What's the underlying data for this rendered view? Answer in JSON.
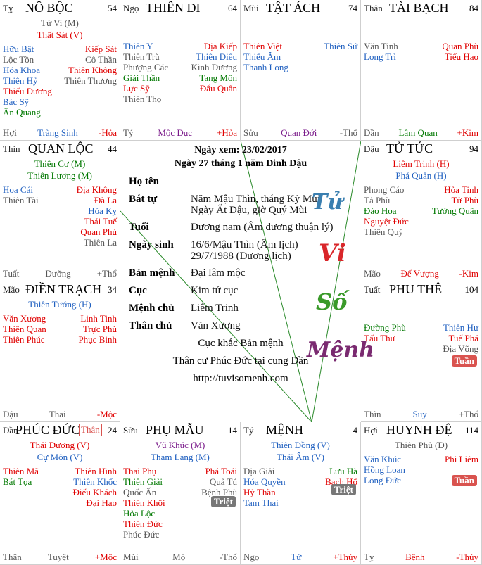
{
  "palaces": {
    "no_boc": {
      "branch": "Tỵ",
      "name": "NÔ BỘC",
      "num": "54",
      "main": [
        {
          "t": "Tử Vi (M)",
          "c": "gray"
        },
        {
          "t": "Thất Sát (V)",
          "c": "red"
        }
      ],
      "rows": [
        [
          "Hữu Bật",
          "blue",
          "Kiếp Sát",
          "red"
        ],
        [
          "Lộc Tồn",
          "gray",
          "Cô Thần",
          "gray"
        ],
        [
          "Hóa Khoa",
          "blue",
          "Thiên Không",
          "red"
        ],
        [
          "Thiên Hỷ",
          "blue",
          "Thiên Thương",
          "gray"
        ],
        [
          "Thiếu Dương",
          "red",
          "",
          ""
        ],
        [
          "Bác Sỹ",
          "blue",
          "",
          ""
        ],
        [
          "Ân Quang",
          "green",
          "",
          ""
        ]
      ],
      "bot": [
        "Hợi",
        "Tràng Sinh",
        "-Hỏa"
      ],
      "botc": [
        "gray",
        "blue",
        "red"
      ]
    },
    "thien_di": {
      "branch": "Ngọ",
      "name": "THIÊN DI",
      "num": "64",
      "main": [],
      "rows": [
        [
          "Thiên Y",
          "blue",
          "Địa Kiếp",
          "red"
        ],
        [
          "Thiên Trù",
          "gray",
          "Thiên Diêu",
          "blue"
        ],
        [
          "Phượng Các",
          "gray",
          "Kình Dương",
          "gray"
        ],
        [
          "Giải Thần",
          "green",
          "Tang Môn",
          "green"
        ],
        [
          "Lực Sỹ",
          "red",
          "Đẩu Quân",
          "red"
        ],
        [
          "Thiên Thọ",
          "gray",
          "",
          ""
        ]
      ],
      "bot": [
        "Tý",
        "Mộc Dục",
        "+Hỏa"
      ],
      "botc": [
        "gray",
        "purple",
        "red"
      ]
    },
    "tat_ach": {
      "branch": "Mùi",
      "name": "TẬT ÁCH",
      "num": "74",
      "main": [],
      "rows": [
        [
          "Thiên Việt",
          "red",
          "Thiên Sứ",
          "blue"
        ],
        [
          "Thiếu Âm",
          "blue",
          "",
          ""
        ],
        [
          "Thanh Long",
          "blue",
          "",
          ""
        ]
      ],
      "bot": [
        "Sửu",
        "Quan Đới",
        "-Thổ"
      ],
      "botc": [
        "gray",
        "purple",
        "gray"
      ]
    },
    "tai_bach": {
      "branch": "Thân",
      "name": "TÀI BẠCH",
      "num": "84",
      "main": [],
      "rows": [
        [
          "Văn Tinh",
          "gray",
          "Quan Phù",
          "red"
        ],
        [
          "Long Trì",
          "blue",
          "Tiểu Hao",
          "red"
        ]
      ],
      "bot": [
        "Dần",
        "Lâm Quan",
        "+Kim"
      ],
      "botc": [
        "gray",
        "green",
        "red"
      ]
    },
    "quan_loc": {
      "branch": "Thìn",
      "name": "QUAN LỘC",
      "num": "44",
      "main": [
        {
          "t": "Thiên Cơ (M)",
          "c": "green"
        },
        {
          "t": "Thiên Lương (M)",
          "c": "green"
        }
      ],
      "rows": [
        [
          "Hoa Cái",
          "blue",
          "Địa Không",
          "red"
        ],
        [
          "Thiên Tài",
          "gray",
          "Đà La",
          "red"
        ],
        [
          "",
          "",
          "Hóa Kỵ",
          "blue"
        ],
        [
          "",
          "",
          "Thái Tuế",
          "red"
        ],
        [
          "",
          "",
          "Quan Phủ",
          "red"
        ],
        [
          "",
          "",
          "Thiên La",
          "gray"
        ]
      ],
      "bot": [
        "Tuất",
        "Dưỡng",
        "+Thổ"
      ],
      "botc": [
        "gray",
        "gray",
        "gray"
      ]
    },
    "tu_tuc": {
      "branch": "Dậu",
      "name": "TỬ TỨC",
      "num": "94",
      "main": [
        {
          "t": "Liêm Trinh (H)",
          "c": "red"
        },
        {
          "t": "Phá Quân (H)",
          "c": "blue"
        }
      ],
      "rows": [
        [
          "Phong Cáo",
          "gray",
          "Hỏa Tinh",
          "red"
        ],
        [
          "Tả Phù",
          "gray",
          "Tử Phù",
          "red"
        ],
        [
          "Đào Hoa",
          "green",
          "Tướng Quân",
          "green"
        ],
        [
          "Nguyệt Đức",
          "red",
          "",
          ""
        ],
        [
          "Thiên Quý",
          "gray",
          "",
          ""
        ]
      ],
      "bot": [
        "Mão",
        "Đế Vượng",
        "-Kim"
      ],
      "botc": [
        "gray",
        "red",
        "red"
      ]
    },
    "dien_trach": {
      "branch": "Mão",
      "name": "ĐIỀN TRẠCH",
      "num": "34",
      "main": [
        {
          "t": "Thiên Tướng (H)",
          "c": "blue"
        }
      ],
      "rows": [
        [
          "Văn Xương",
          "red",
          "Linh Tinh",
          "red"
        ],
        [
          "Thiên Quan",
          "red",
          "Trực Phù",
          "red"
        ],
        [
          "Thiên Phúc",
          "red",
          "Phục Binh",
          "red"
        ]
      ],
      "bot": [
        "Dậu",
        "Thai",
        "-Mộc"
      ],
      "botc": [
        "gray",
        "gray",
        "red"
      ]
    },
    "phu_the": {
      "branch": "Tuất",
      "name": "PHU THÊ",
      "num": "104",
      "main": [],
      "rows": [
        [
          "Đường Phù",
          "green",
          "Thiên Hư",
          "blue"
        ],
        [
          "Tấu Thư",
          "red",
          "Tuế Phá",
          "red"
        ],
        [
          "",
          "",
          "Địa Võng",
          "gray"
        ]
      ],
      "badge": {
        "t": "Tuần",
        "c": "#d9534f"
      },
      "bot": [
        "Thìn",
        "Suy",
        "+Thổ"
      ],
      "botc": [
        "gray",
        "blue",
        "gray"
      ]
    },
    "phuc_duc": {
      "branch": "Dần",
      "name": "PHÚC ĐỨC",
      "num": "24",
      "tag": "Thân",
      "main": [
        {
          "t": "Thái Dương (V)",
          "c": "red"
        },
        {
          "t": "Cự Môn (V)",
          "c": "blue"
        }
      ],
      "rows": [
        [
          "Thiên Mã",
          "red",
          "Thiên Hình",
          "red"
        ],
        [
          "Bát Tọa",
          "green",
          "Thiên Khốc",
          "blue"
        ],
        [
          "",
          "",
          "Điếu Khách",
          "red"
        ],
        [
          "",
          "",
          "Đại Hao",
          "red"
        ]
      ],
      "bot": [
        "Thân",
        "Tuyệt",
        "+Mộc"
      ],
      "botc": [
        "gray",
        "gray",
        "red"
      ]
    },
    "phu_mau": {
      "branch": "Sửu",
      "name": "PHỤ MẪU",
      "num": "14",
      "main": [
        {
          "t": "Vũ Khúc (M)",
          "c": "purple"
        },
        {
          "t": "Tham Lang (M)",
          "c": "blue"
        }
      ],
      "rows": [
        [
          "Thai Phụ",
          "red",
          "Phá Toái",
          "red"
        ],
        [
          "Thiên Giải",
          "green",
          "Quả Tú",
          "gray"
        ],
        [
          "Quốc Ấn",
          "gray",
          "Bệnh Phù",
          "gray"
        ],
        [
          "Thiên Khôi",
          "red",
          "",
          ""
        ],
        [
          "Hỏa Lộc",
          "green",
          "",
          ""
        ],
        [
          "Thiên Đức",
          "red",
          "",
          ""
        ],
        [
          "Phúc Đức",
          "gray",
          "",
          ""
        ]
      ],
      "badge": {
        "t": "Triệt",
        "c": "#777"
      },
      "bot": [
        "Mùi",
        "Mộ",
        "-Thổ"
      ],
      "botc": [
        "gray",
        "gray",
        "gray"
      ]
    },
    "menh": {
      "branch": "Tý",
      "name": "MỆNH",
      "num": "4",
      "main": [
        {
          "t": "Thiên Đồng (V)",
          "c": "blue"
        },
        {
          "t": "Thái Âm (V)",
          "c": "blue"
        }
      ],
      "rows": [
        [
          "Địa Giải",
          "gray",
          "Lưu Hà",
          "green"
        ],
        [
          "Hóa Quyền",
          "blue",
          "Bạch Hổ",
          "red"
        ],
        [
          "Hỷ Thần",
          "red",
          "",
          ""
        ],
        [
          "Tam Thai",
          "blue",
          "",
          ""
        ]
      ],
      "badge": {
        "t": "Triệt",
        "c": "#777"
      },
      "bot": [
        "Ngọ",
        "Tử",
        "+Thủy"
      ],
      "botc": [
        "gray",
        "blue",
        "red"
      ]
    },
    "huynh_de": {
      "branch": "Hợi",
      "name": "HUYNH ĐỆ",
      "num": "114",
      "main": [
        {
          "t": "Thiên Phủ (Đ)",
          "c": "gray"
        }
      ],
      "rows": [
        [
          "Văn Khúc",
          "blue",
          "Phi Liêm",
          "red"
        ],
        [
          "Hồng Loan",
          "blue",
          "",
          ""
        ],
        [
          "Long Đức",
          "blue",
          "",
          ""
        ]
      ],
      "badge": {
        "t": "Tuần",
        "c": "#d9534f"
      },
      "bot": [
        "Tỵ",
        "Bệnh",
        "-Thủy"
      ],
      "botc": [
        "gray",
        "red",
        "red"
      ]
    }
  },
  "center": {
    "view_date": "Ngày xem: 23/02/2017",
    "lunar_date": "Ngày 27 tháng 1 năm Đinh Dậu",
    "name_label": "Họ tên",
    "name_value": "",
    "battu_label": "Bát tự",
    "battu_value": "Năm Mậu Thìn, tháng Kỷ Mùi",
    "battu_value2": "Ngày Ất Dậu, giờ Quý Mùi",
    "age_label": "Tuổi",
    "age_value": "Dương nam (Âm dương thuận lý)",
    "birth_label": "Ngày sinh",
    "birth_value": "16/6/Mậu Thìn (Âm lịch)",
    "birth_value2": "29/7/1988 (Dương lịch)",
    "banmenh_label": "Bản mệnh",
    "banmenh_value": "Đại lâm mộc",
    "cuc_label": "Cục",
    "cuc_value": "Kim tứ cục",
    "menhchu_label": "Mệnh chủ",
    "menhchu_value": "Liêm Trinh",
    "thanchu_label": "Thân chủ",
    "thanchu_value": "Văn Xương",
    "note1": "Cục khắc Bản mệnh",
    "note2": "Thân cư Phúc Đức tại cung Dần",
    "url": "http://tuvisomenh.com",
    "logo": [
      "Tử",
      "Vi",
      "Số",
      "Mệnh"
    ]
  }
}
